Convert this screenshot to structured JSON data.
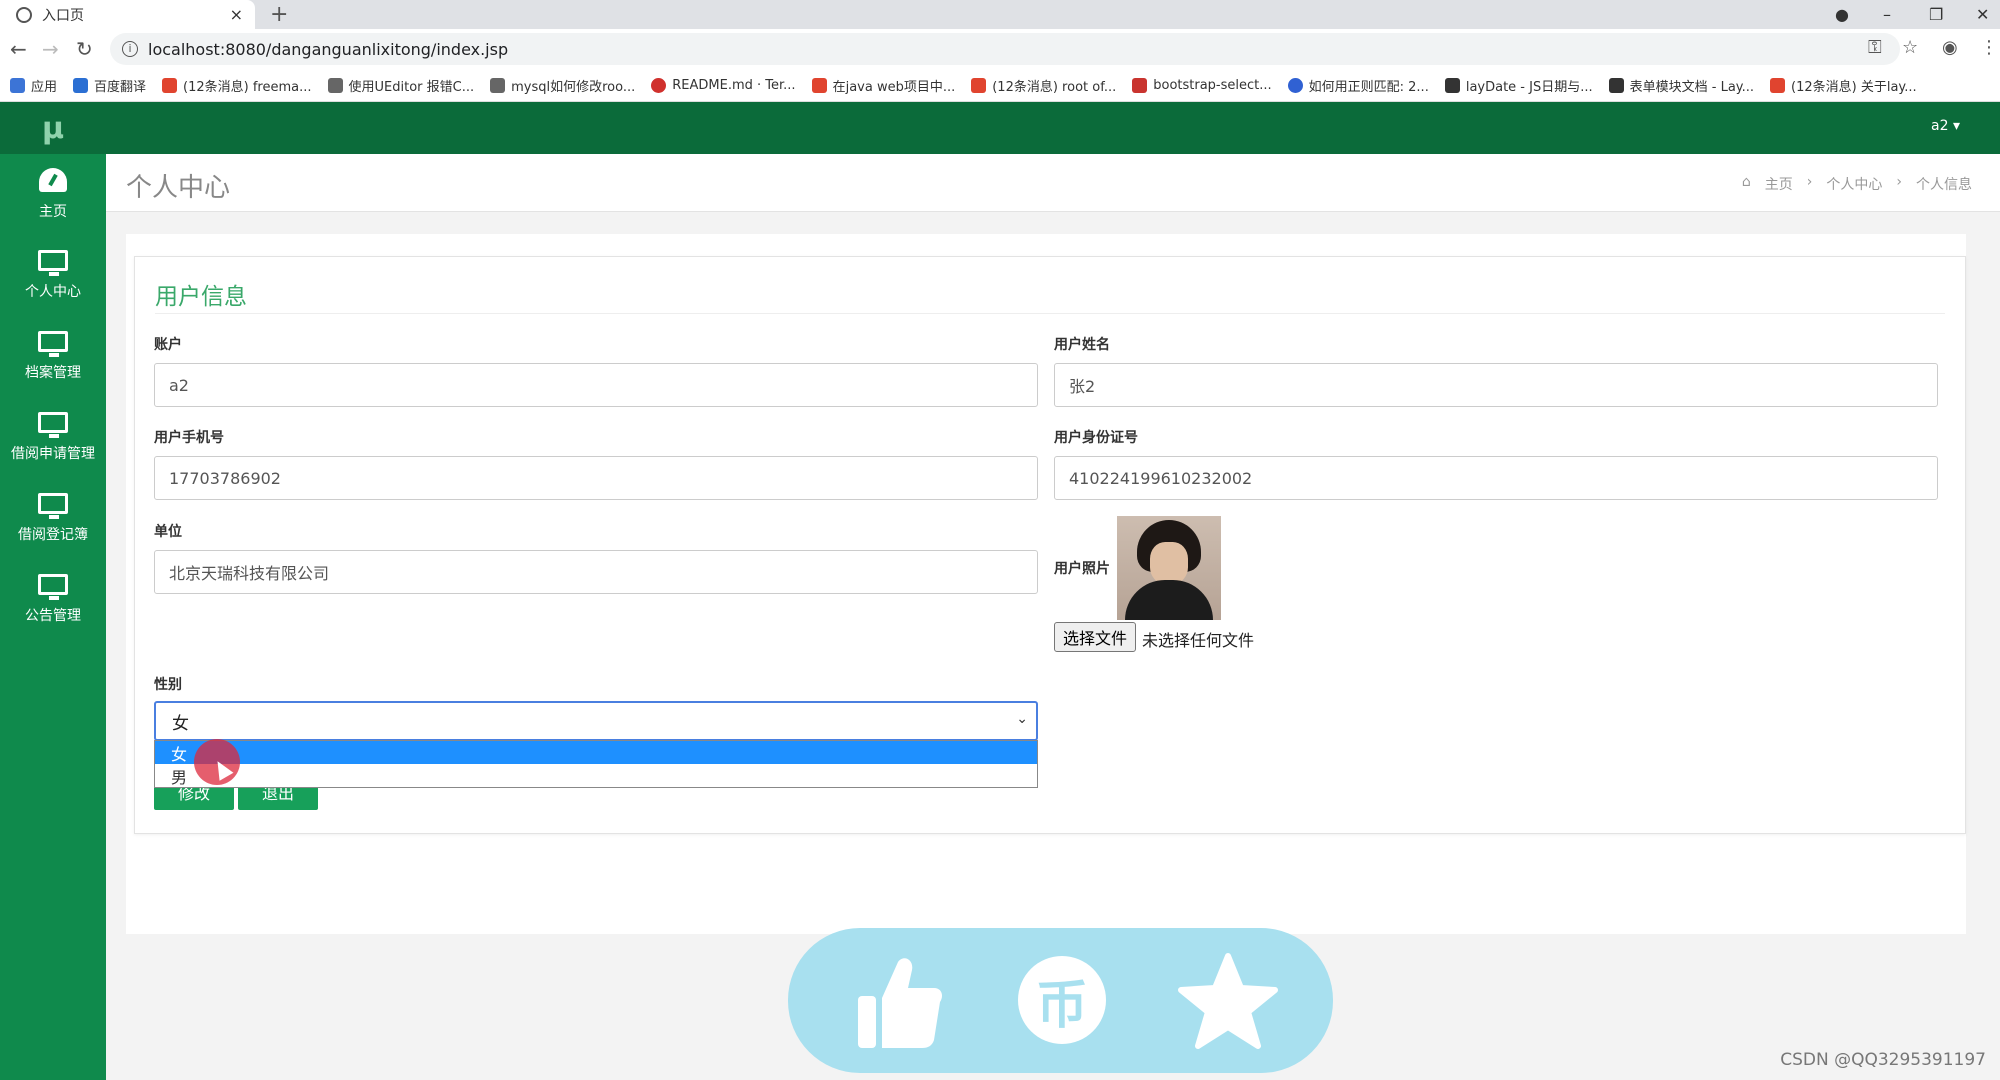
{
  "browser": {
    "tab_title": "入口页",
    "tab_close": "×",
    "new_tab": "+",
    "url": "localhost:8080/danganguanlixitong/index.jsp",
    "window_controls": {
      "minimize": "–",
      "restore": "❐",
      "close": "✕"
    },
    "bookmarks": [
      {
        "label": "应用",
        "color": "#3c74d6"
      },
      {
        "label": "百度翻译",
        "color": "#2b6fd3"
      },
      {
        "label": "(12条消息) freema...",
        "color": "#e0442f"
      },
      {
        "label": "使用UEditor 报错C...",
        "color": "#666666"
      },
      {
        "label": "mysql如何修改roo...",
        "color": "#666666"
      },
      {
        "label": "README.md · Ter...",
        "color": "#d0312d"
      },
      {
        "label": "在java web项目中...",
        "color": "#e0442f"
      },
      {
        "label": "(12条消息) root of...",
        "color": "#e0442f"
      },
      {
        "label": "bootstrap-select...",
        "color": "#c9342f"
      },
      {
        "label": "如何用正则匹配: 2...",
        "color": "#3061d3"
      },
      {
        "label": "layDate - JS日期与...",
        "color": "#333333"
      },
      {
        "label": "表单模块文档 - Lay...",
        "color": "#333333"
      },
      {
        "label": "(12条消息) 关于lay...",
        "color": "#e0442f"
      }
    ]
  },
  "app": {
    "brand": "μ",
    "user": "a2 ▾",
    "nav": [
      {
        "label": "主页",
        "icon": "dashboard-icon"
      },
      {
        "label": "个人中心",
        "icon": "monitor-icon"
      },
      {
        "label": "档案管理",
        "icon": "monitor-icon"
      },
      {
        "label": "借阅申请管理",
        "icon": "monitor-icon"
      },
      {
        "label": "借阅登记簿",
        "icon": "monitor-icon"
      },
      {
        "label": "公告管理",
        "icon": "monitor-icon"
      }
    ],
    "page_title": "个人中心",
    "breadcrumb": [
      "主页",
      "个人中心",
      "个人信息"
    ],
    "breadcrumb_sep": "›",
    "breadcrumb_home_icon": "⌂"
  },
  "form": {
    "title": "用户信息",
    "account": {
      "label": "账户",
      "value": "a2"
    },
    "name": {
      "label": "用户姓名",
      "value": "张2"
    },
    "phone": {
      "label": "用户手机号",
      "value": "17703786902"
    },
    "idcard": {
      "label": "用户身份证号",
      "value": "410224199610232002"
    },
    "unit": {
      "label": "单位",
      "value": "北京天瑞科技有限公司"
    },
    "photo": {
      "label": "用户照片",
      "choose_file": "选择文件",
      "no_file": "未选择任何文件"
    },
    "gender": {
      "label": "性别",
      "value": "女",
      "options": [
        "女",
        "男"
      ]
    },
    "buttons": {
      "submit": "修改",
      "back": "退出"
    }
  },
  "watermark": "CSDN @QQ3295391197",
  "colors": {
    "sidebar": "#0f8a4c",
    "topbar": "#0b6b3a",
    "accent": "#3aa86a",
    "action_bar": "#a8e0ef",
    "dropdown_highlight": "#1e90ff"
  }
}
